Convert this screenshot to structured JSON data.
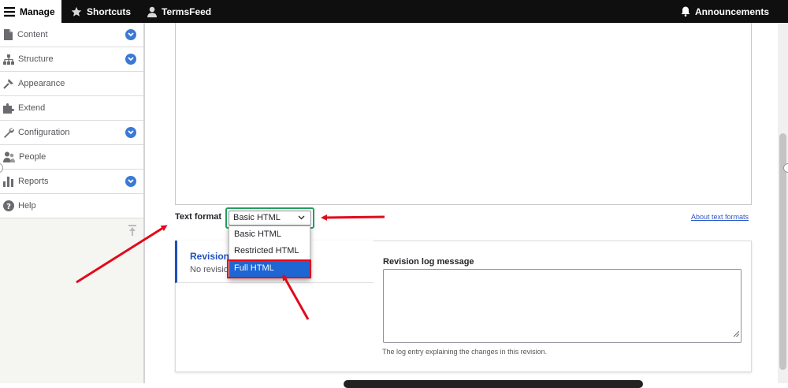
{
  "toolbar": {
    "manage": "Manage",
    "shortcuts": "Shortcuts",
    "user": "TermsFeed",
    "announcements": "Announcements"
  },
  "sidebar": {
    "items": [
      {
        "label": "Content",
        "icon": "content-icon",
        "expandable": true
      },
      {
        "label": "Structure",
        "icon": "structure-icon",
        "expandable": true
      },
      {
        "label": "Appearance",
        "icon": "appearance-icon",
        "expandable": false
      },
      {
        "label": "Extend",
        "icon": "extend-icon",
        "expandable": false
      },
      {
        "label": "Configuration",
        "icon": "wrench-icon",
        "expandable": true
      },
      {
        "label": "People",
        "icon": "people-icon",
        "expandable": false
      },
      {
        "label": "Reports",
        "icon": "reports-icon",
        "expandable": true
      },
      {
        "label": "Help",
        "icon": "help-icon",
        "expandable": false
      }
    ]
  },
  "text_format": {
    "label": "Text format",
    "selected": "Basic HTML",
    "options": [
      "Basic HTML",
      "Restricted HTML",
      "Full HTML"
    ],
    "highlighted_option": "Full HTML",
    "about_link": "About text formats"
  },
  "revision": {
    "title": "Revision",
    "subtitle": "No revisio",
    "log_label": "Revision log message",
    "log_value": "",
    "log_help": "The log entry explaining the changes in this revision."
  },
  "colors": {
    "toolbar_bg": "#0f0f0f",
    "accent_blue": "#1f4fbf",
    "selected_option": "#1d66d4",
    "annotation_red": "#e10a1a",
    "focus_green": "#22a05a"
  }
}
